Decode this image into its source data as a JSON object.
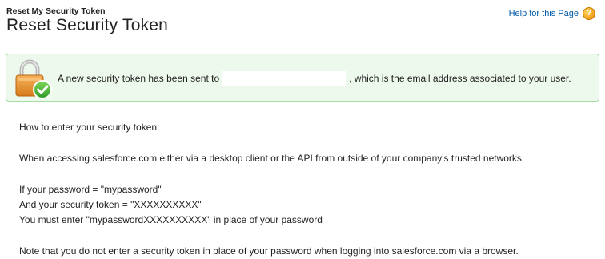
{
  "header": {
    "subtitle": "Reset My Security Token",
    "title": "Reset Security Token",
    "help_link": "Help for this Page",
    "help_icon_glyph": "?"
  },
  "confirmation": {
    "text_before": "A new security token has been sent to",
    "email": "",
    "text_after": ", which is the email address associated to your user."
  },
  "instructions": {
    "heading": "How to enter your security token:",
    "context": "When accessing salesforce.com either via a desktop client or the API from outside of your company's trusted networks:",
    "example_password": "If your password = \"mypassword\"",
    "example_token": "And your security token = \"XXXXXXXXXX\"",
    "example_enter": "You must enter \"mypasswordXXXXXXXXXX\" in place of your password",
    "note": "Note that you do not enter a security token in place of your password when logging into salesforce.com via a browser."
  },
  "icons": {
    "lock": "lock-check-icon",
    "help": "help-icon"
  },
  "colors": {
    "confirm_background": "#eef9ee",
    "confirm_border": "#a7dba7",
    "link": "#015ba7"
  }
}
